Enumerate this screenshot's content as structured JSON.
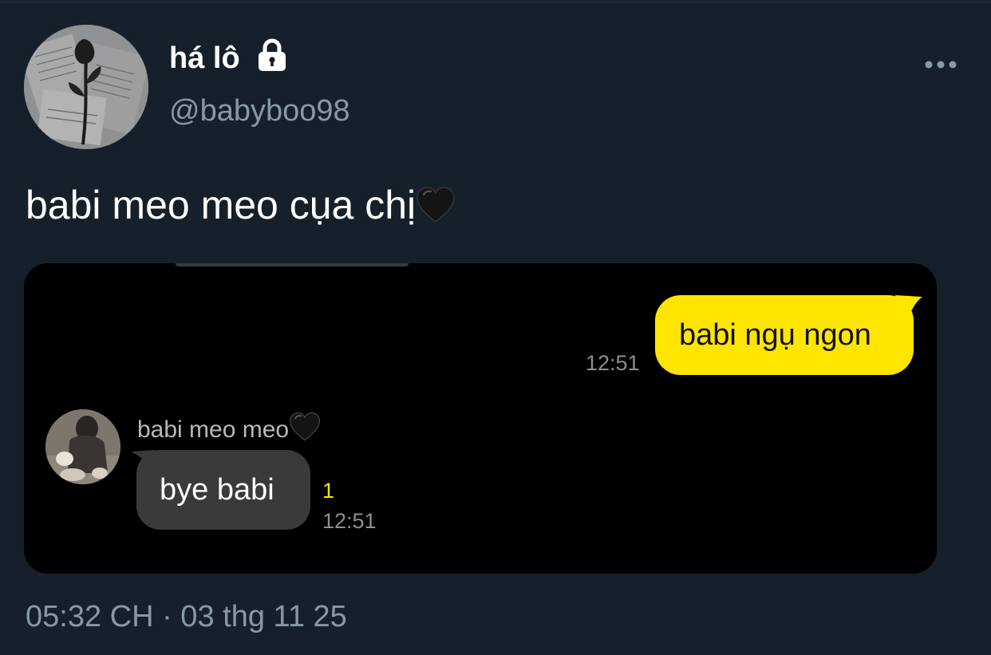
{
  "tweet": {
    "display_name": "há lô",
    "handle": "@babyboo98",
    "text": "babi meo meo cụa chị",
    "timestamp": "05:32 CH · 03 thg 11 25",
    "lock_icon": "lock-icon",
    "more_icon": "more-icon"
  },
  "media": {
    "outgoing": {
      "text": "babi ngụ ngon",
      "time": "12:51"
    },
    "incoming": {
      "contact_name": "babi meo meo",
      "text": "bye babi",
      "unread": "1",
      "time": "12:51"
    }
  },
  "colors": {
    "background": "#15202b",
    "secondary_text": "#8899a6",
    "outgoing_bubble": "#fee500",
    "incoming_bubble": "#3a3a3c"
  }
}
